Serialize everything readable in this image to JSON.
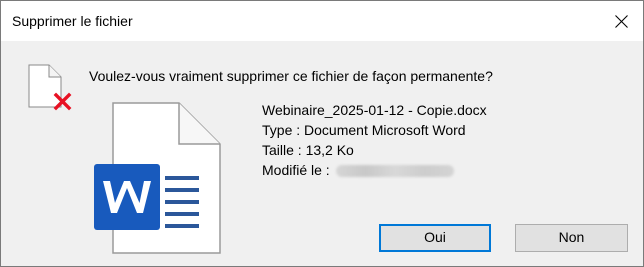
{
  "dialog": {
    "title": "Supprimer le fichier",
    "close_icon": "close-icon",
    "question": "Voulez-vous vraiment supprimer ce fichier de façon permanente?",
    "file": {
      "name": "Webinaire_2025-01-12 - Copie.docx",
      "type_line": "Type : Document Microsoft Word",
      "size_line": "Taille : 13,2 Ko",
      "modified_label": "Modifié le :"
    },
    "icons": {
      "small": "delete-document-icon",
      "large": "word-document-icon"
    },
    "buttons": {
      "yes_label": "Oui",
      "no_label": "Non"
    },
    "colors": {
      "accent": "#0078d7",
      "word_blue": "#185abd",
      "delete_red": "#e81123"
    }
  }
}
